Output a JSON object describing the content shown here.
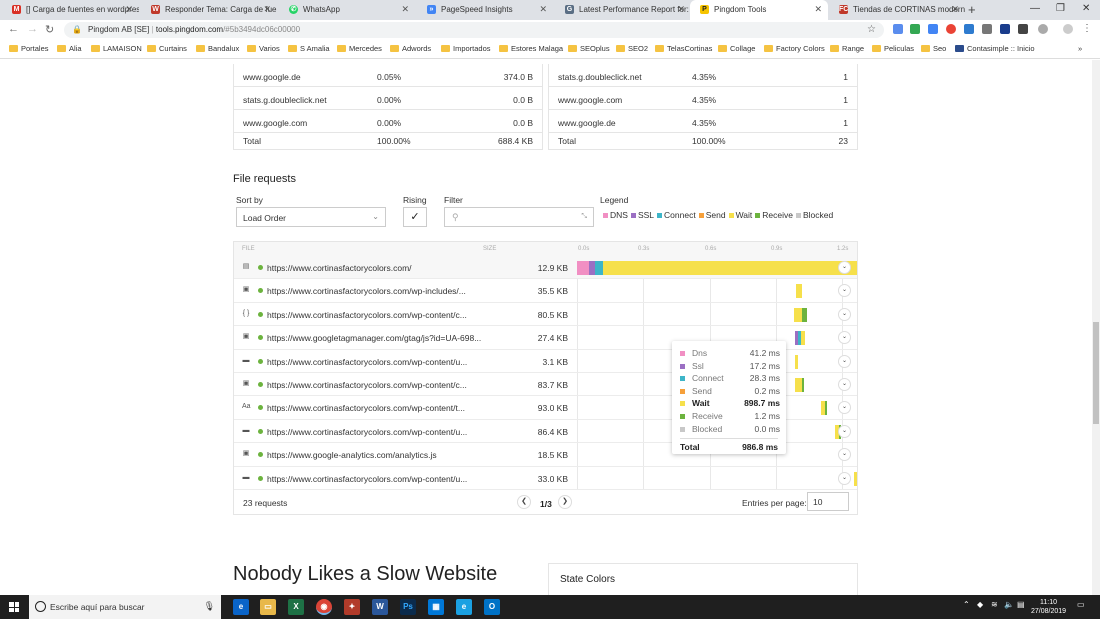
{
  "browser": {
    "tabs": [
      {
        "label": "[] Carga de fuentes en wordpres",
        "icon": "gmail-icon",
        "color": "#d93025"
      },
      {
        "label": "Responder Tema: Carga de fuent",
        "icon": "wordpress-forum-icon",
        "color": "#c0392b"
      },
      {
        "label": "WhatsApp",
        "icon": "whatsapp-icon",
        "color": "#25d366"
      },
      {
        "label": "PageSpeed Insights",
        "icon": "pagespeed-icon",
        "color": "#4285f4"
      },
      {
        "label": "Latest Performance Report for: h",
        "icon": "gtmetrix-icon",
        "color": "#5a6e84"
      },
      {
        "label": "Pingdom Tools",
        "icon": "pingdom-icon",
        "color": "#f6c400"
      },
      {
        "label": "Tiendas de CORTINAS modernas",
        "icon": "cortinas-icon",
        "color": "#c0392b"
      }
    ],
    "address": {
      "site": "Pingdom AB [SE]",
      "host": "tools.pingdom.com",
      "path": "/#5b3494dc06c00000"
    },
    "bookmarks": [
      "Portales",
      "Alia",
      "LAMAISON",
      "Curtains",
      "Bandalux",
      "Varios",
      "S Amalia",
      "Mercedes",
      "Adwords",
      "Importados",
      "Estores Malaga",
      "SEOplus",
      "SEO2",
      "TelasCortinas",
      "Collage",
      "Factory Colors",
      "Range",
      "Peliculas",
      "Seo",
      "Contasimple :: Inicio"
    ]
  },
  "top_tables": {
    "left": {
      "rows": [
        {
          "domain": "www.google.de",
          "percent": "0.05%",
          "size": "374.0 B"
        },
        {
          "domain": "stats.g.doubleclick.net",
          "percent": "0.00%",
          "size": "0.0 B"
        },
        {
          "domain": "www.google.com",
          "percent": "0.00%",
          "size": "0.0 B"
        }
      ],
      "total": {
        "label": "Total",
        "percent": "100.00%",
        "size": "688.4 KB"
      }
    },
    "right": {
      "rows": [
        {
          "domain": "stats.g.doubleclick.net",
          "percent": "4.35%",
          "count": "1"
        },
        {
          "domain": "www.google.com",
          "percent": "4.35%",
          "count": "1"
        },
        {
          "domain": "www.google.de",
          "percent": "4.35%",
          "count": "1"
        }
      ],
      "total": {
        "label": "Total",
        "percent": "100.00%",
        "count": "23"
      }
    }
  },
  "file_requests": {
    "title": "File requests",
    "sort_label": "Sort by",
    "sort_value": "Load Order",
    "rising_label": "Rising",
    "filter_label": "Filter",
    "filter_placeholder": "",
    "legend_label": "Legend",
    "legend": [
      {
        "name": "DNS",
        "color": "#f18fc3"
      },
      {
        "name": "SSL",
        "color": "#9b6fc3"
      },
      {
        "name": "Connect",
        "color": "#3db5c8"
      },
      {
        "name": "Send",
        "color": "#f6a03a"
      },
      {
        "name": "Wait",
        "color": "#f6e04b"
      },
      {
        "name": "Receive",
        "color": "#6cb33e"
      },
      {
        "name": "Blocked",
        "color": "#c8c8c8"
      }
    ],
    "header": {
      "file": "FILE",
      "size": "SIZE",
      "ticks": [
        "0.0s",
        "0.3s",
        "0.6s",
        "0.9s",
        "1.2s"
      ]
    },
    "requests": [
      {
        "type_icon": "document-icon",
        "glyph": "▤",
        "url": "https://www.cortinasfactorycolors.com/",
        "size": "12.9 KB"
      },
      {
        "type_icon": "image-icon",
        "glyph": "▣",
        "url": "https://www.cortinasfactorycolors.com/wp-includes/...",
        "size": "35.5 KB"
      },
      {
        "type_icon": "css-icon",
        "glyph": "{ }",
        "url": "https://www.cortinasfactorycolors.com/wp-content/c...",
        "size": "80.5 KB"
      },
      {
        "type_icon": "image-icon",
        "glyph": "▣",
        "url": "https://www.googletagmanager.com/gtag/js?id=UA-698...",
        "size": "27.4 KB"
      },
      {
        "type_icon": "image-icon",
        "glyph": "▬",
        "url": "https://www.cortinasfactorycolors.com/wp-content/u...",
        "size": "3.1 KB"
      },
      {
        "type_icon": "image-icon",
        "glyph": "▣",
        "url": "https://www.cortinasfactorycolors.com/wp-content/c...",
        "size": "83.7 KB"
      },
      {
        "type_icon": "font-icon",
        "glyph": "Aa",
        "url": "https://www.cortinasfactorycolors.com/wp-content/t...",
        "size": "93.0 KB"
      },
      {
        "type_icon": "image-icon",
        "glyph": "▬",
        "url": "https://www.cortinasfactorycolors.com/wp-content/u...",
        "size": "86.4 KB"
      },
      {
        "type_icon": "image-icon",
        "glyph": "▣",
        "url": "https://www.google-analytics.com/analytics.js",
        "size": "18.5 KB"
      },
      {
        "type_icon": "image-icon",
        "glyph": "▬",
        "url": "https://www.cortinasfactorycolors.com/wp-content/u...",
        "size": "33.0 KB"
      }
    ],
    "timing_tooltip": {
      "rows": [
        {
          "name": "Dns",
          "value": "41.2 ms",
          "color": "#f18fc3"
        },
        {
          "name": "Ssl",
          "value": "17.2 ms",
          "color": "#9b6fc3"
        },
        {
          "name": "Connect",
          "value": "28.3 ms",
          "color": "#3db5c8"
        },
        {
          "name": "Send",
          "value": "0.2 ms",
          "color": "#f6a03a"
        },
        {
          "name": "Wait",
          "value": "898.7 ms",
          "color": "#f6e04b"
        },
        {
          "name": "Receive",
          "value": "1.2 ms",
          "color": "#6cb33e"
        },
        {
          "name": "Blocked",
          "value": "0.0 ms",
          "color": "#c8c8c8"
        }
      ],
      "total_label": "Total",
      "total_value": "986.8 ms"
    },
    "footer": {
      "count": "23 requests",
      "page": "1/3",
      "entries_label": "Entries per page:",
      "entries_value": "10"
    }
  },
  "below": {
    "headline": "Nobody Likes a Slow Website",
    "state_colors_title": "State Colors"
  },
  "taskbar": {
    "search_placeholder": "Escribe aquí para buscar",
    "time": "11:10",
    "date": "27/08/2019"
  }
}
